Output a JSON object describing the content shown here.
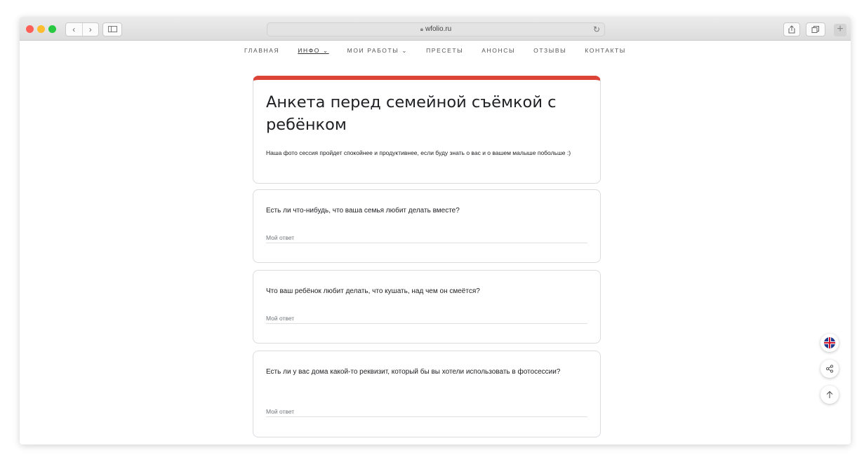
{
  "browser": {
    "url": "wfolio.ru",
    "back_icon": "chevron-left-icon",
    "forward_icon": "chevron-right-icon"
  },
  "nav": {
    "items": [
      {
        "label": "ГЛАВНАЯ"
      },
      {
        "label": "ИНФО ⌄"
      },
      {
        "label": "МОИ РАБОТЫ ⌄"
      },
      {
        "label": "ПРЕСЕТЫ"
      },
      {
        "label": "АНОНСЫ"
      },
      {
        "label": "ОТЗЫВЫ"
      },
      {
        "label": "КОНТАКТЫ"
      }
    ]
  },
  "form": {
    "title": "Анкета перед семейной съёмкой с ребёнком",
    "description": "Наша фото сессия пройдет спокойнее и продуктивнее, если буду знать о вас и о вашем малыше побольше :)",
    "accent_color": "#db4437",
    "questions": [
      {
        "title": "Есть ли что-нибудь, что ваша семья любит делать вместе?",
        "placeholder": "Мой ответ"
      },
      {
        "title": "Что ваш ребёнок любит делать, что кушать, над чем он смеётся?",
        "placeholder": "Мой ответ"
      },
      {
        "title": "Есть ли у вас дома какой-то реквизит, который бы вы хотели использовать в фотосессии?",
        "placeholder": "Мой ответ"
      }
    ]
  },
  "floating": {
    "language_icon": "uk-flag-icon",
    "share_icon": "share-icon",
    "up_icon": "arrow-up-icon"
  }
}
